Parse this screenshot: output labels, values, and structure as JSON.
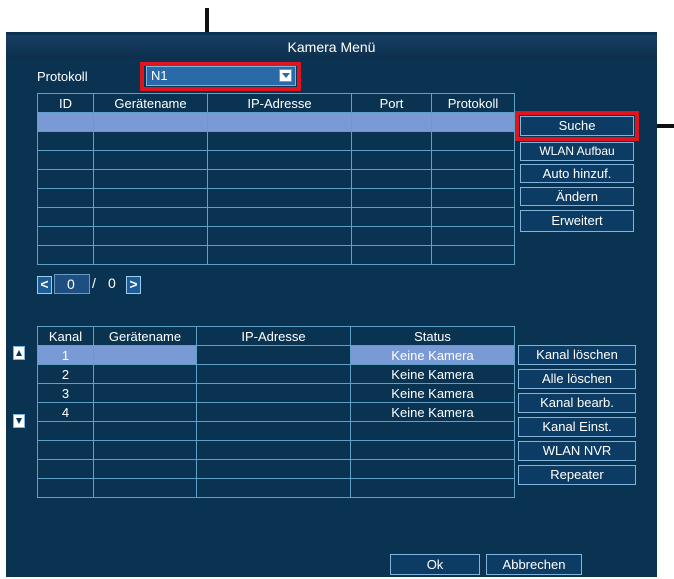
{
  "title": "Kamera Menü",
  "protocol": {
    "label": "Protokoll",
    "value": "N1"
  },
  "top_table": {
    "headers": [
      "ID",
      "Gerätename",
      "IP-Adresse",
      "Port",
      "Protokoll"
    ]
  },
  "side_buttons": [
    "Suche",
    "WLAN Aufbau",
    "Auto hinzuf.",
    "Ändern",
    "Erweitert"
  ],
  "pager": {
    "current": "0",
    "separator": "/",
    "total": "0",
    "prev": "<",
    "next": ">"
  },
  "bottom_table": {
    "headers": [
      "Kanal",
      "Gerätename",
      "IP-Adresse",
      "Status"
    ],
    "rows": [
      {
        "kanal": "1",
        "status": "Keine Kamera"
      },
      {
        "kanal": "2",
        "status": "Keine Kamera"
      },
      {
        "kanal": "3",
        "status": "Keine Kamera"
      },
      {
        "kanal": "4",
        "status": "Keine Kamera"
      }
    ]
  },
  "channel_buttons": [
    "Kanal löschen",
    "Alle löschen",
    "Kanal bearb.",
    "Kanal Einst.",
    "WLAN NVR",
    "Repeater"
  ],
  "footer": {
    "ok": "Ok",
    "cancel": "Abbrechen"
  },
  "colors": {
    "background": "#0a3352",
    "highlight": "#e0141e",
    "selected_row": "#7a9ad6"
  }
}
